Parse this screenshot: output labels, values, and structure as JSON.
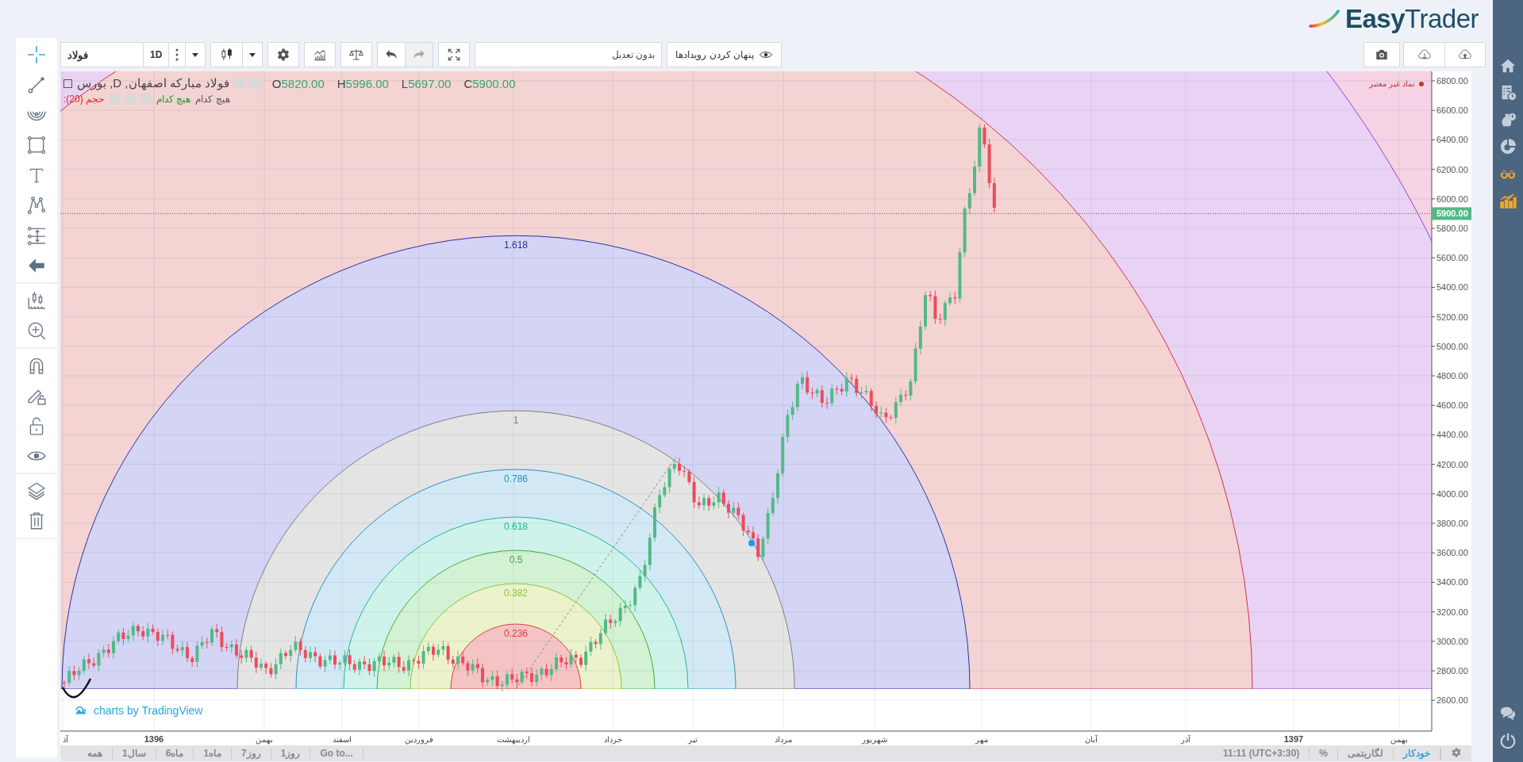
{
  "header": {
    "logo": "**Easy**Trader"
  },
  "toolbar": {
    "symbol": "فولاد",
    "interval": "1D",
    "adjustment": "بدون تعدیل",
    "events_button": "پنهان کردن رویدادها"
  },
  "left_toolbar": [
    [
      {
        "kind": "crosshair",
        "selected": true
      },
      {
        "kind": "trend",
        "selected": false
      },
      {
        "kind": "arcs",
        "selected": false
      },
      {
        "kind": "rect",
        "selected": false
      },
      {
        "kind": "text",
        "selected": false
      },
      {
        "kind": "pattern",
        "selected": false
      },
      {
        "kind": "measure",
        "selected": false
      },
      {
        "kind": "back",
        "selected": false
      }
    ],
    [
      {
        "kind": "candles",
        "selected": false
      },
      {
        "kind": "zoom",
        "selected": false
      }
    ],
    [
      {
        "kind": "magnet",
        "selected": false
      },
      {
        "kind": "pencil",
        "selected": false
      },
      {
        "kind": "unlock",
        "selected": false
      },
      {
        "kind": "eye",
        "selected": false
      }
    ],
    [
      {
        "kind": "layers",
        "selected": false
      },
      {
        "kind": "trash",
        "selected": false
      }
    ]
  ],
  "legend": {
    "title": "فولاد مبارکه اصفهان, D, بورس",
    "ohlc": [
      {
        "key": "C",
        "value": "5900.00"
      },
      {
        "key": "L",
        "value": "5697.00"
      },
      {
        "key": "H",
        "value": "5996.00"
      },
      {
        "key": "O",
        "value": "5820.00"
      }
    ],
    "volume": "حجم (20):",
    "indicator_1": "هیچ کدام",
    "indicator_2": "هیچ کدام"
  },
  "invalid_symbol_badge": "نماد غیر معتبر",
  "fib_levels": [
    "1.618",
    "1",
    "0.786",
    "0.618",
    "0.5",
    "0.382",
    "0.236"
  ],
  "price_axis": {
    "labels": [
      "6800.00",
      "6600.00",
      "6400.00",
      "6200.00",
      "6000.00",
      "5800.00",
      "5600.00",
      "5400.00",
      "5200.00",
      "5000.00",
      "4800.00",
      "4600.00",
      "4400.00",
      "4200.00",
      "4000.00",
      "3800.00",
      "3600.00",
      "3400.00",
      "3200.00",
      "3000.00",
      "2800.00",
      "2600.00"
    ],
    "last_price": "5900.00"
  },
  "time_axis": {
    "labels": [
      {
        "text": "بهمن",
        "kind": "month"
      },
      {
        "text": "1397",
        "kind": "year"
      },
      {
        "text": "آذر",
        "kind": "month"
      },
      {
        "text": "آبان",
        "kind": "month"
      },
      {
        "text": "مهر",
        "kind": "month"
      },
      {
        "text": "شهریور",
        "kind": "month"
      },
      {
        "text": "مرداد",
        "kind": "month"
      },
      {
        "text": "تیر",
        "kind": "month"
      },
      {
        "text": "خرداد",
        "kind": "month"
      },
      {
        "text": "اردیبهشت",
        "kind": "month"
      },
      {
        "text": "فروردین",
        "kind": "month"
      },
      {
        "text": "اسفند",
        "kind": "month"
      },
      {
        "text": "بهمن",
        "kind": "month"
      },
      {
        "text": "1396",
        "kind": "year"
      },
      {
        "text": "آذ",
        "kind": "month"
      }
    ]
  },
  "chart_credit": "charts by TradingView",
  "range_buttons": [
    "Go to...",
    "1روز",
    "7روز",
    "1ماه",
    "6ماه",
    "1سال",
    "همه"
  ],
  "clock": "11:11 (UTC+3:30)",
  "scale_options": [
    {
      "label": "خودکار",
      "selected": true
    },
    {
      "label": "لگاریتمی",
      "selected": false
    },
    {
      "label": "%",
      "selected": false
    }
  ],
  "right_nav": [
    {
      "kind": "home",
      "color": "#c3cfdc"
    },
    {
      "kind": "checklist",
      "color": "#c3cfdc"
    },
    {
      "kind": "moneybag",
      "color": "#c3cfdc"
    },
    {
      "kind": "pie",
      "color": "#c3cfdc"
    },
    {
      "kind": "binoculars",
      "color": "#f5a623"
    },
    {
      "kind": "growth",
      "color": "#f5a623"
    }
  ],
  "right_nav_bottom": [
    {
      "kind": "chat",
      "color": "#c3cfdc"
    },
    {
      "kind": "power",
      "color": "#c3cfdc"
    }
  ]
}
